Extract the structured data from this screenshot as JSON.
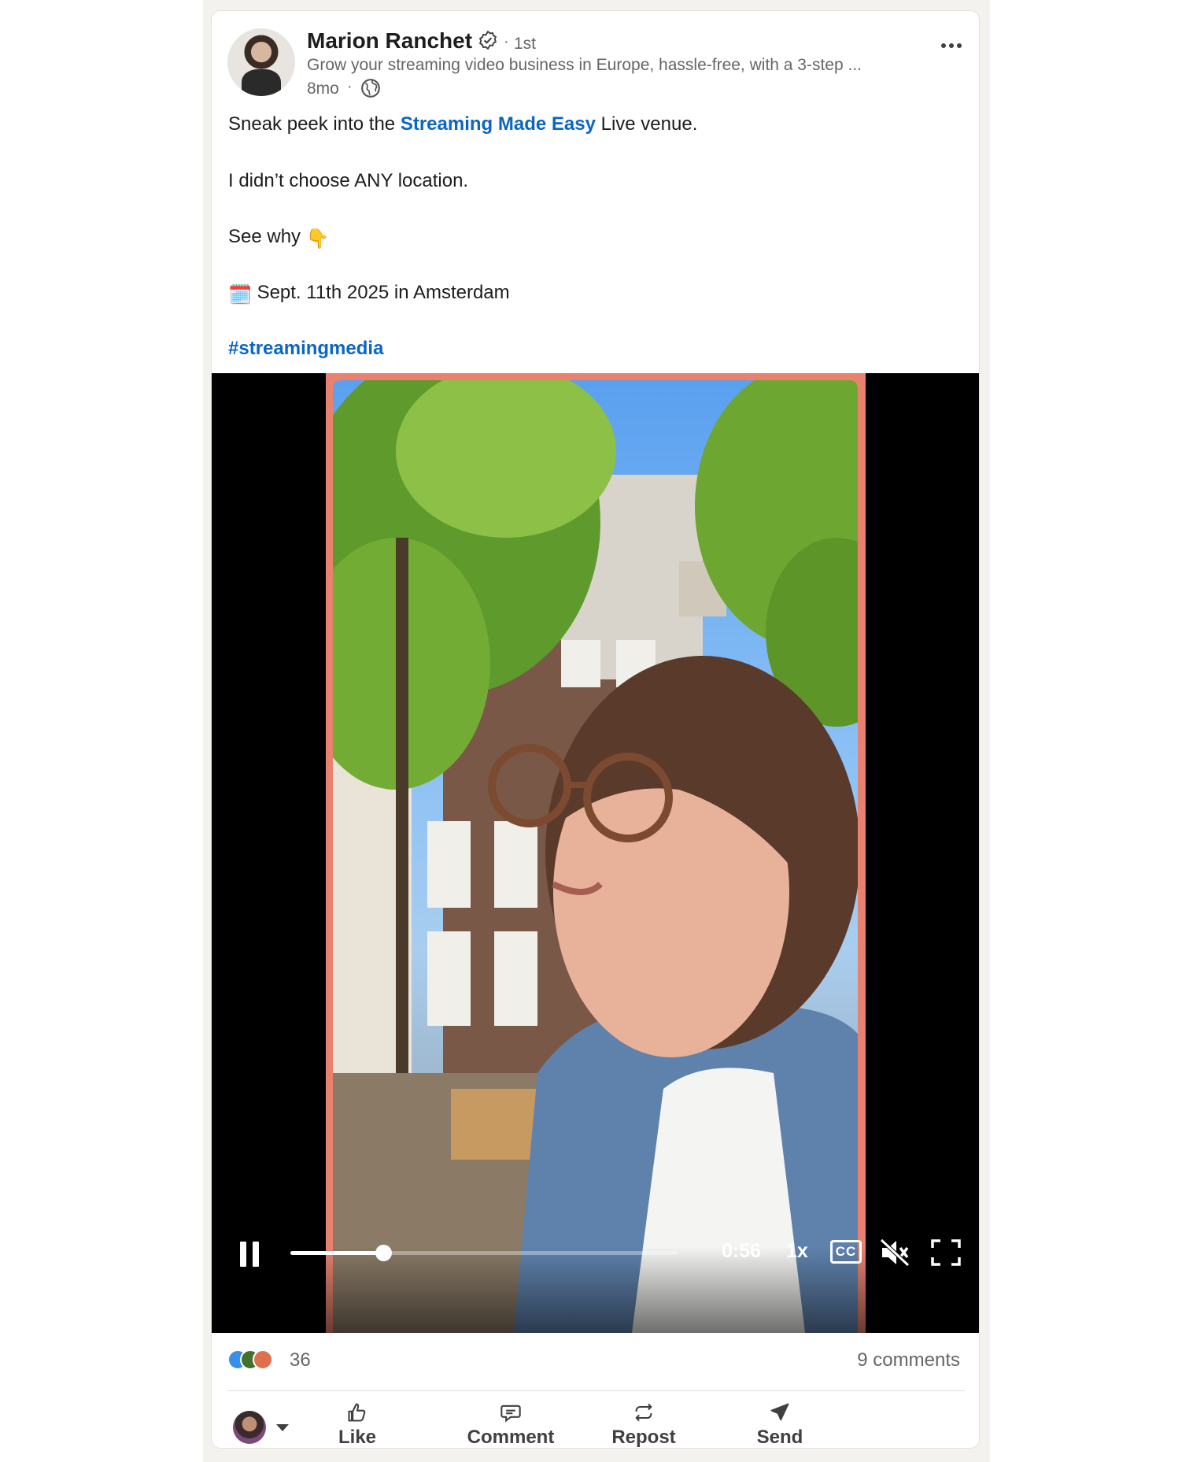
{
  "post": {
    "author": {
      "name": "Marion Ranchet",
      "connection": "1st",
      "headline": "Grow your streaming video business in Europe, hassle-free, with a 3-step ...",
      "time": "8mo"
    },
    "body": {
      "line1_prefix": "Sneak peek into the ",
      "line1_link": "Streaming Made Easy",
      "line1_suffix": " Live venue.",
      "line2": "I didn’t choose ANY location.",
      "line3": "See why",
      "line3_emoji": "👇",
      "line4_emoji": "🗓️",
      "line4": "Sept. 11th 2025 in Amsterdam",
      "hashtag": "#streamingmedia"
    },
    "video": {
      "time": "0:56",
      "speed": "1x",
      "captions_label": "CC",
      "progress": 0.24,
      "muted": true
    },
    "social": {
      "reaction_count": "36",
      "comments": "9 comments"
    },
    "actions": {
      "like": "Like",
      "comment": "Comment",
      "repost": "Repost",
      "send": "Send"
    }
  },
  "colors": {
    "link": "#0a66c2",
    "video_border": "#e8826f"
  },
  "icons": [
    "verified-icon",
    "globe-icon",
    "more-icon",
    "pause-icon",
    "cc-icon",
    "mute-icon",
    "fullscreen-icon",
    "like-icon",
    "comment-icon",
    "repost-icon",
    "send-icon"
  ]
}
